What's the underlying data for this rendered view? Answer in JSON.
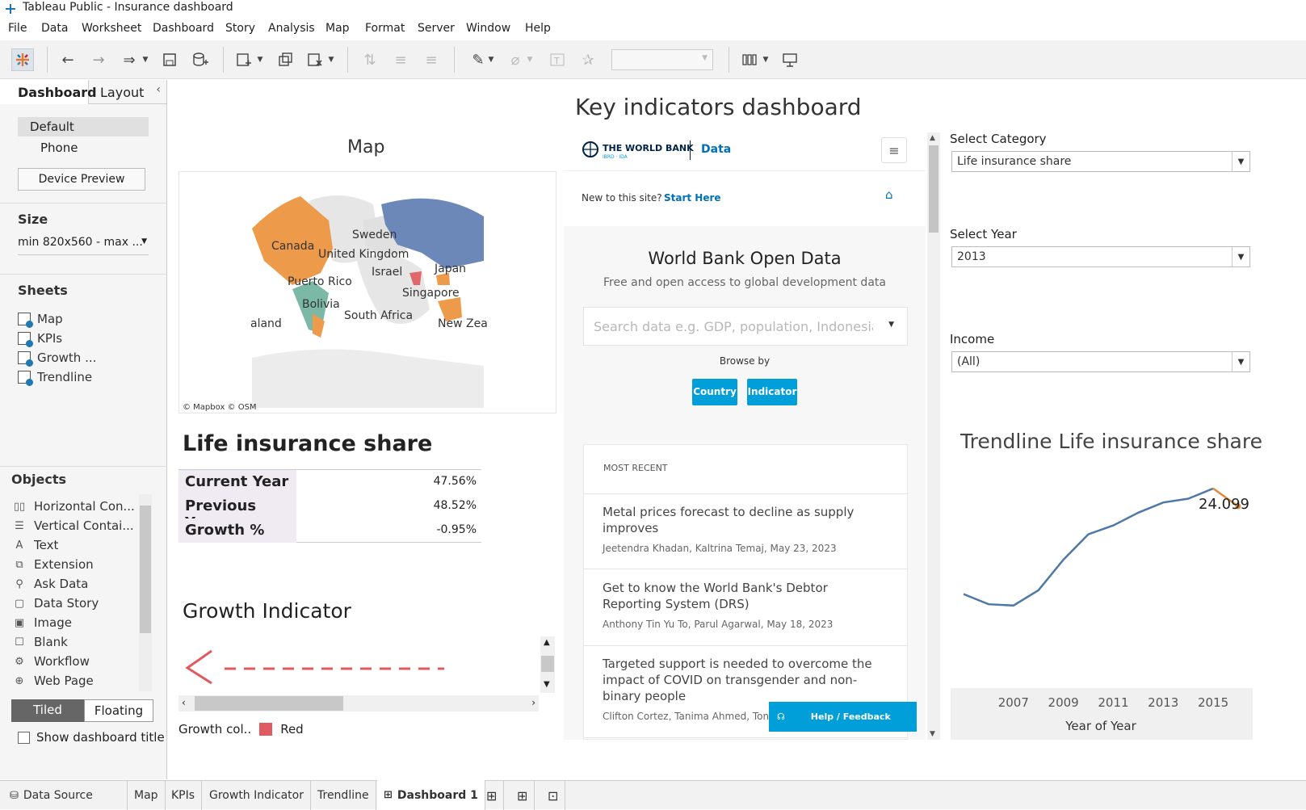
{
  "window": {
    "title": "Tableau Public - Insurance dashboard"
  },
  "menu": [
    "File",
    "Data",
    "Worksheet",
    "Dashboard",
    "Story",
    "Analysis",
    "Map",
    "Format",
    "Server",
    "Window",
    "Help"
  ],
  "left": {
    "tabs": {
      "dashboard": "Dashboard",
      "layout": "Layout"
    },
    "device": {
      "default": "Default",
      "phone": "Phone",
      "preview": "Device Preview"
    },
    "size": {
      "title": "Size",
      "value": "min 820x560 - max ..."
    },
    "sheets": {
      "title": "Sheets",
      "items": [
        "Map",
        "KPIs",
        "Growth ...",
        "Trendline"
      ]
    },
    "objects": {
      "title": "Objects",
      "items": [
        "Horizontal Con...",
        "Vertical Contai...",
        "Text",
        "Extension",
        "Ask Data",
        "Data Story",
        "Image",
        "Blank",
        "Workflow",
        "Web Page"
      ]
    },
    "mode": {
      "tiled": "Tiled",
      "floating": "Floating"
    },
    "show_title": "Show dashboard title"
  },
  "dashboard": {
    "title": "Key indicators dashboard",
    "map": {
      "title": "Map",
      "credit": "© Mapbox © OSM",
      "labels": [
        "Sweden",
        "Canada",
        "United Kingdom",
        "Japan",
        "Israel",
        "Puerto Rico",
        "Singapore",
        "Bolivia",
        "South Africa",
        "aland",
        "New Zea"
      ]
    },
    "kpi": {
      "title": "Life insurance share",
      "rows": [
        {
          "label": "Current Year",
          "value": "47.56%"
        },
        {
          "label": "Previous Year",
          "value": "48.52%"
        },
        {
          "label": "Growth %",
          "value": "-0.95%"
        }
      ]
    },
    "growth": {
      "title": "Growth Indicator",
      "legend_label": "Growth col..",
      "legend_value": "Red"
    },
    "worldbank": {
      "logo": "THE WORLD BANK",
      "logo_sub": "IBRD · IDA",
      "data": "Data",
      "new_text": "New to this site?",
      "start": "Start Here",
      "hero_title": "World Bank Open Data",
      "hero_sub": "Free and open access to global development data",
      "search_placeholder": "Search data e.g. GDP, population, Indonesia",
      "browse": "Browse by",
      "country": "Country",
      "indicator": "Indicator",
      "most_recent": "MOST RECENT",
      "news": [
        {
          "title": "Metal prices forecast to decline as supply improves",
          "authors": "Jeetendra Khadan, Kaltrina Temaj,  May 23, 2023"
        },
        {
          "title": "Get to know the World Bank's Debtor Reporting System (DRS)",
          "authors": "Anthony Tin Yu To, Parul Agarwal,  May 18, 2023"
        },
        {
          "title": "Targeted support is needed to overcome the impact of COVID on transgender and non-binary people",
          "authors": "Clifton Cortez, Tanima Ahmed, Toni Joe"
        }
      ],
      "help": "Help / Feedback"
    },
    "filters": {
      "category_label": "Select Category",
      "category_value": "Life insurance share",
      "year_label": "Select Year",
      "year_value": "2013",
      "income_label": "Income",
      "income_value": "(All)"
    },
    "trend": {
      "title": "Trendline  Life insurance share",
      "last_label": "24.099"
    }
  },
  "bottom": {
    "data_source": "Data Source",
    "tabs": [
      "Map",
      "KPIs",
      "Growth Indicator",
      "Trendline",
      "Dashboard 1"
    ]
  },
  "chart_data": {
    "type": "line",
    "title": "Trendline  Life insurance share",
    "xlabel": "Year of Year",
    "x_ticks": [
      "2007",
      "2009",
      "2011",
      "2013",
      "2015"
    ],
    "x": [
      2005,
      2006,
      2007,
      2008,
      2009,
      2010,
      2011,
      2012,
      2013,
      2014,
      2015,
      2016
    ],
    "values": [
      34.5,
      33.7,
      33.6,
      34.8,
      37.2,
      39.2,
      39.9,
      40.9,
      41.7,
      42.0,
      42.8,
      41.4
    ],
    "highlight_last": "24.099",
    "line_color": "#4e79a7",
    "last_segment_color": "#e08a3a"
  }
}
